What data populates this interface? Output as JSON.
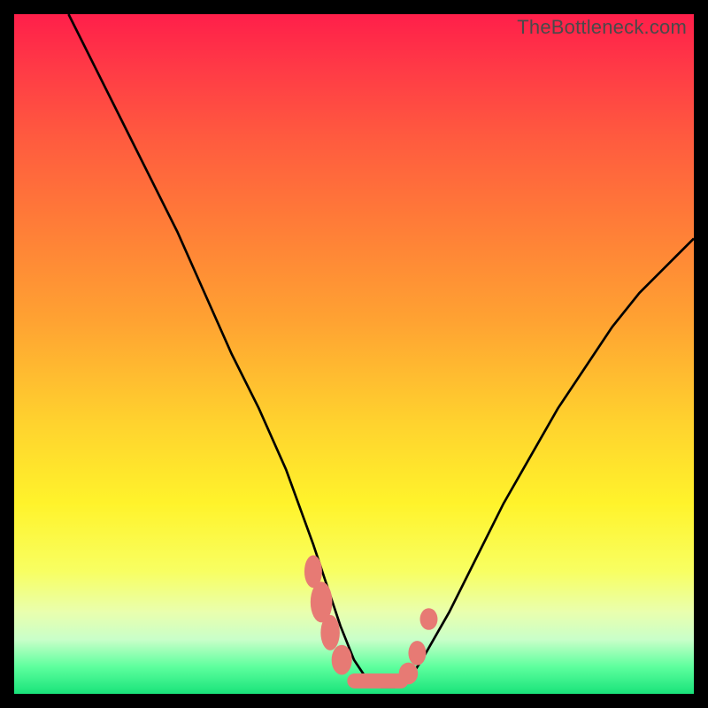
{
  "watermark": "TheBottleneck.com",
  "colors": {
    "frame": "#000000",
    "curve": "#000000",
    "marker": "#e77a74",
    "gradient_top": "#ff1f4a",
    "gradient_bottom": "#19e37a"
  },
  "chart_data": {
    "type": "line",
    "title": "",
    "xlabel": "",
    "ylabel": "",
    "xlim": [
      0,
      100
    ],
    "ylim": [
      0,
      100
    ],
    "grid": false,
    "legend": false,
    "series": [
      {
        "name": "bottleneck-curve",
        "x": [
          8,
          12,
          16,
          20,
          24,
          28,
          32,
          36,
          40,
          44,
          46,
          48,
          50,
          52,
          54,
          56,
          58,
          60,
          64,
          68,
          72,
          76,
          80,
          84,
          88,
          92,
          96,
          100
        ],
        "y": [
          100,
          92,
          84,
          76,
          68,
          59,
          50,
          42,
          33,
          22,
          16,
          10,
          5,
          2,
          1,
          1,
          2,
          5,
          12,
          20,
          28,
          35,
          42,
          48,
          54,
          59,
          63,
          67
        ]
      }
    ],
    "annotations": [
      {
        "name": "optimal-zone-markers",
        "shape": "rounded-blob",
        "color": "#e77a74",
        "points_xy": [
          [
            44,
            18
          ],
          [
            45,
            14
          ],
          [
            46,
            10
          ],
          [
            48,
            5
          ],
          [
            50,
            2
          ],
          [
            52,
            1
          ],
          [
            54,
            1
          ],
          [
            56,
            1.5
          ],
          [
            58,
            3
          ],
          [
            59,
            6
          ],
          [
            61,
            11
          ]
        ]
      }
    ]
  }
}
